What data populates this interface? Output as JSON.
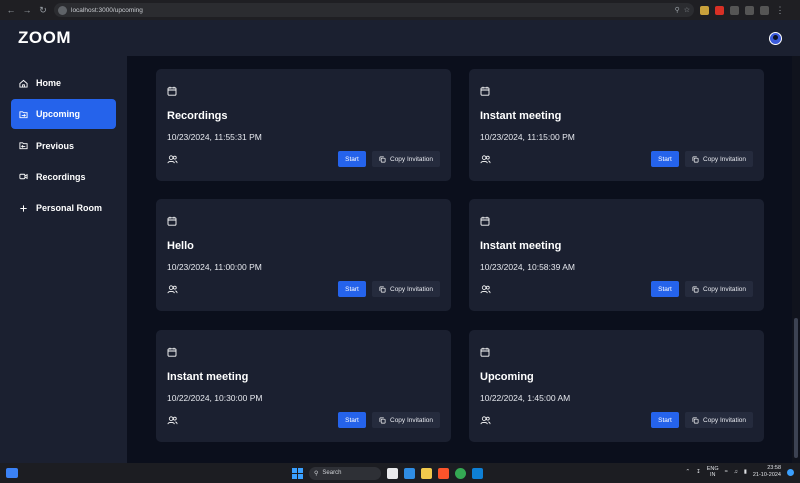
{
  "browser": {
    "url": "localhost:3000/upcoming"
  },
  "app": {
    "logo": "ZOOM"
  },
  "sidebar": {
    "items": [
      {
        "label": "Home",
        "icon": "home-icon"
      },
      {
        "label": "Upcoming",
        "icon": "folder-upcoming-icon",
        "active": true
      },
      {
        "label": "Previous",
        "icon": "folder-previous-icon"
      },
      {
        "label": "Recordings",
        "icon": "video-icon"
      },
      {
        "label": "Personal Room",
        "icon": "plus-icon"
      }
    ]
  },
  "cards": [
    {
      "title": "Recordings",
      "time": "10/23/2024, 11:55:31 PM"
    },
    {
      "title": "Instant meeting",
      "time": "10/23/2024, 11:15:00 PM"
    },
    {
      "title": "Hello",
      "time": "10/23/2024, 11:00:00 PM"
    },
    {
      "title": "Instant meeting",
      "time": "10/23/2024, 10:58:39 AM"
    },
    {
      "title": "Instant meeting",
      "time": "10/22/2024, 10:30:00 PM"
    },
    {
      "title": "Upcoming",
      "time": "10/22/2024, 1:45:00 AM"
    }
  ],
  "card_buttons": {
    "start": "Start",
    "copy": "Copy Invitation"
  },
  "colors": {
    "accent": "#2563eb",
    "card": "#1b2030",
    "background": "#0b0f1c"
  },
  "taskbar": {
    "search_placeholder": "Search",
    "lang_top": "ENG",
    "lang_bottom": "IN",
    "time": "23:58",
    "date": "21-10-2024"
  }
}
